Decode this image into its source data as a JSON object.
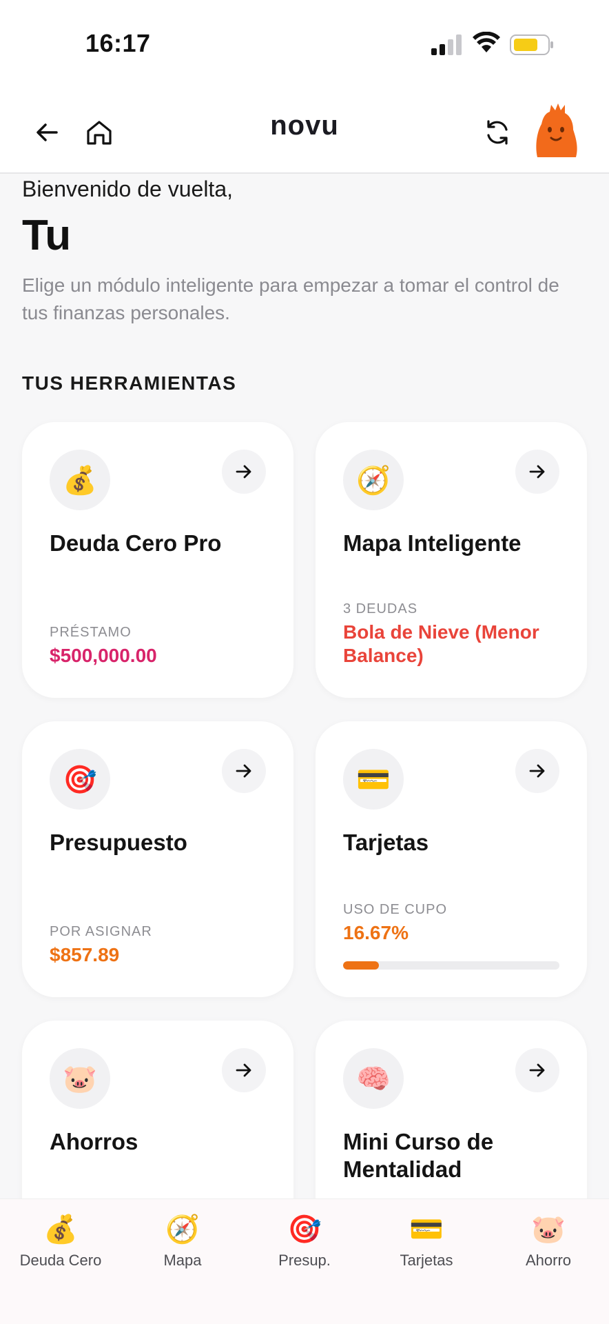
{
  "status_bar": {
    "time": "16:17"
  },
  "header": {
    "logo": "novu"
  },
  "intro": {
    "welcome": "Bienvenido de vuelta,",
    "name": "Tu",
    "description": "Elige un módulo inteligente para empezar a tomar el control de tus finanzas personales."
  },
  "section_title": "TUS HERRAMIENTAS",
  "cards": [
    {
      "emoji": "💰",
      "emoji_name": "money-bag-icon",
      "title": "Deuda Cero Pro",
      "label": "PRÉSTAMO",
      "value": "$500,000.00",
      "value_color": "#d8246a"
    },
    {
      "emoji": "🧭",
      "emoji_name": "compass-icon",
      "title": "Mapa Inteligente",
      "label": "3 DEUDAS",
      "value": "Bola de Nieve (Menor Balance)",
      "value_color": "#e9443a"
    },
    {
      "emoji": "🎯",
      "emoji_name": "target-icon",
      "title": "Presupuesto",
      "label": "POR ASIGNAR",
      "value": "$857.89",
      "value_color": "#ee7214"
    },
    {
      "emoji": "💳",
      "emoji_name": "credit-card-icon",
      "title": "Tarjetas",
      "label": "USO DE CUPO",
      "value": "16.67%",
      "value_color": "#ee7214",
      "progress": 0.1667
    },
    {
      "emoji": "🐷",
      "emoji_name": "pig-icon",
      "title": "Ahorros"
    },
    {
      "emoji": "🧠",
      "emoji_name": "brain-icon",
      "title": "Mini Curso de Mentalidad"
    }
  ],
  "bottom_nav": [
    {
      "emoji": "💰",
      "label": "Deuda Cero"
    },
    {
      "emoji": "🧭",
      "label": "Mapa"
    },
    {
      "emoji": "🎯",
      "label": "Presup."
    },
    {
      "emoji": "💳",
      "label": "Tarjetas"
    },
    {
      "emoji": "🐷",
      "label": "Ahorro"
    }
  ],
  "colors": {
    "accent": "#ee7214",
    "pink": "#d8246a",
    "red": "#e9443a",
    "avatar": "#f26a1b"
  }
}
